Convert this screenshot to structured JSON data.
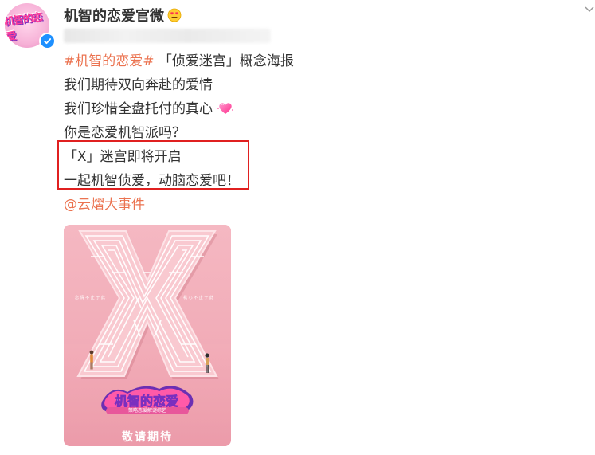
{
  "account": {
    "name": "机智的恋爱官微",
    "avatar_icon": "show-logo-avatar",
    "badge_icon": "verified-badge-icon",
    "name_emoji_icon": "heart-eyes-icon"
  },
  "post": {
    "lines": [
      {
        "hashtag": "#机智的恋爱#",
        "text": " 「侦爱迷宫」概念海报"
      },
      {
        "text": "我们期待双向奔赴的爱情"
      },
      {
        "text": "我们珍惜全盘托付的真心",
        "icon": "heart-icon"
      },
      {
        "text": "你是恋爱机智派吗？"
      },
      {
        "text": "「X」迷宫即将开启"
      },
      {
        "text": "一起机智侦爱，动脑恋爱吧！"
      }
    ],
    "mention": "@云熠大事件"
  },
  "poster": {
    "caption": "敬请期待",
    "side_left": "恋 情 不 止 于 此",
    "side_right": "机 心 不 止 于 此",
    "subtitle": "策略恋爱解谜综艺"
  },
  "colors": {
    "link": "#eb7350",
    "highlight": "#e02020",
    "poster_bg": "#f1a9b4"
  }
}
